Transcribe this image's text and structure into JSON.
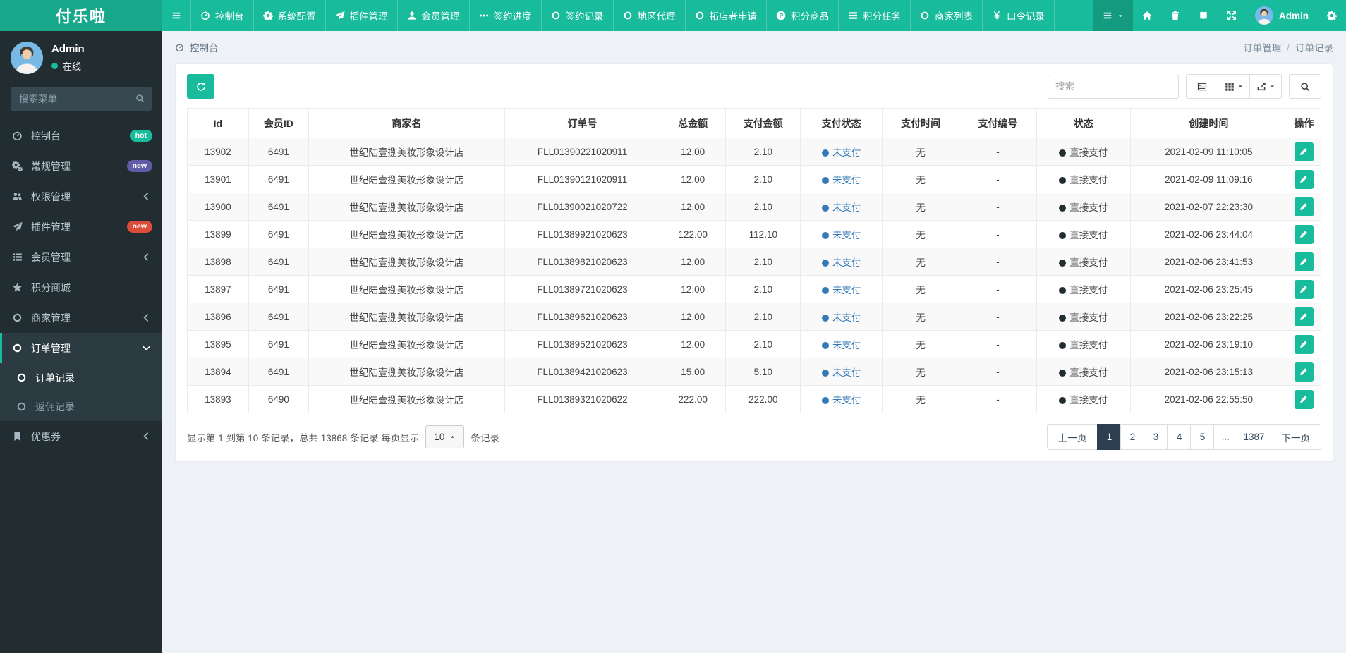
{
  "navbar": {
    "brand": "付乐啦",
    "toggle_icon": "bars",
    "menu": [
      {
        "key": "dashboard",
        "icon": "gauge",
        "label": "控制台"
      },
      {
        "key": "system-config",
        "icon": "gear",
        "label": "系统配置"
      },
      {
        "key": "plugin-manage",
        "icon": "plane",
        "label": "插件管理"
      },
      {
        "key": "member-manage",
        "icon": "user",
        "label": "会员管理"
      },
      {
        "key": "sign-progress",
        "icon": "ellipsis",
        "label": "签约进度"
      },
      {
        "key": "sign-records",
        "icon": "circle-o",
        "label": "签约记录"
      },
      {
        "key": "area-agent",
        "icon": "circle-o",
        "label": "地区代理"
      },
      {
        "key": "shop-applications",
        "icon": "circle-o",
        "label": "拓店者申请"
      },
      {
        "key": "points-goods",
        "icon": "p-circle",
        "label": "积分商品"
      },
      {
        "key": "points-tasks",
        "icon": "th-list",
        "label": "积分任务"
      },
      {
        "key": "merchant-list",
        "icon": "circle-o",
        "label": "商家列表"
      },
      {
        "key": "password-records",
        "icon": "yen",
        "label": "口令记录"
      }
    ],
    "right_icons": [
      {
        "key": "home",
        "icon": "home"
      },
      {
        "key": "clear-cache",
        "icon": "trash"
      },
      {
        "key": "docs",
        "icon": "book"
      },
      {
        "key": "fullscreen",
        "icon": "expand"
      }
    ],
    "user": "Admin"
  },
  "sidebar": {
    "user": {
      "name": "Admin",
      "status": "在线"
    },
    "search_placeholder": "搜索菜单",
    "items": [
      {
        "key": "dashboard",
        "icon": "gauge",
        "label": "控制台",
        "badge": {
          "text": "hot",
          "color": "teal"
        }
      },
      {
        "key": "general-manage",
        "icon": "gears",
        "label": "常规管理",
        "badge": {
          "text": "new",
          "color": "purple"
        }
      },
      {
        "key": "auth-manage",
        "icon": "users",
        "label": "权限管理",
        "collapsible": true
      },
      {
        "key": "plugin-manage",
        "icon": "plane",
        "label": "插件管理",
        "badge": {
          "text": "new",
          "color": "red"
        }
      },
      {
        "key": "member-manage",
        "icon": "th-list",
        "label": "会员管理",
        "collapsible": true
      },
      {
        "key": "points-mall",
        "icon": "star",
        "label": "积分商城"
      },
      {
        "key": "merchant-manage",
        "icon": "circle-o",
        "label": "商家管理",
        "collapsible": true
      },
      {
        "key": "order-manage",
        "icon": "circle-o",
        "label": "订单管理",
        "active": true,
        "expanded": true,
        "children": [
          {
            "key": "order-records",
            "icon": "circle-o",
            "label": "订单记录",
            "active": true
          },
          {
            "key": "rebate-records",
            "icon": "circle-o",
            "label": "返佣记录"
          }
        ]
      },
      {
        "key": "coupons",
        "icon": "bookmark",
        "label": "优惠券",
        "collapsible": true
      }
    ]
  },
  "breadcrumb": {
    "location": "控制台",
    "parent": "订单管理",
    "current": "订单记录"
  },
  "toolbar": {
    "search_placeholder": "搜索"
  },
  "table": {
    "columns": [
      "Id",
      "会员ID",
      "商家名",
      "订单号",
      "总金额",
      "支付金额",
      "支付状态",
      "支付时间",
      "支付编号",
      "状态",
      "创建时间",
      "操作"
    ],
    "column_keys": [
      "id",
      "member-id",
      "merchant",
      "order-no",
      "total",
      "paid",
      "pay-status",
      "pay-time",
      "pay-no",
      "status",
      "created",
      "action"
    ],
    "rows": [
      {
        "id": "13902",
        "member_id": "6491",
        "merchant": "世纪陆壹捌美妆形象设计店",
        "order_no": "FLL01390221020911",
        "total": "12.00",
        "paid": "2.10",
        "pay_status": "未支付",
        "pay_time": "无",
        "pay_no": "-",
        "status": "直接支付",
        "created": "2021-02-09 11:10:05"
      },
      {
        "id": "13901",
        "member_id": "6491",
        "merchant": "世纪陆壹捌美妆形象设计店",
        "order_no": "FLL01390121020911",
        "total": "12.00",
        "paid": "2.10",
        "pay_status": "未支付",
        "pay_time": "无",
        "pay_no": "-",
        "status": "直接支付",
        "created": "2021-02-09 11:09:16"
      },
      {
        "id": "13900",
        "member_id": "6491",
        "merchant": "世纪陆壹捌美妆形象设计店",
        "order_no": "FLL01390021020722",
        "total": "12.00",
        "paid": "2.10",
        "pay_status": "未支付",
        "pay_time": "无",
        "pay_no": "-",
        "status": "直接支付",
        "created": "2021-02-07 22:23:30"
      },
      {
        "id": "13899",
        "member_id": "6491",
        "merchant": "世纪陆壹捌美妆形象设计店",
        "order_no": "FLL01389921020623",
        "total": "122.00",
        "paid": "112.10",
        "pay_status": "未支付",
        "pay_time": "无",
        "pay_no": "-",
        "status": "直接支付",
        "created": "2021-02-06 23:44:04"
      },
      {
        "id": "13898",
        "member_id": "6491",
        "merchant": "世纪陆壹捌美妆形象设计店",
        "order_no": "FLL01389821020623",
        "total": "12.00",
        "paid": "2.10",
        "pay_status": "未支付",
        "pay_time": "无",
        "pay_no": "-",
        "status": "直接支付",
        "created": "2021-02-06 23:41:53"
      },
      {
        "id": "13897",
        "member_id": "6491",
        "merchant": "世纪陆壹捌美妆形象设计店",
        "order_no": "FLL01389721020623",
        "total": "12.00",
        "paid": "2.10",
        "pay_status": "未支付",
        "pay_time": "无",
        "pay_no": "-",
        "status": "直接支付",
        "created": "2021-02-06 23:25:45"
      },
      {
        "id": "13896",
        "member_id": "6491",
        "merchant": "世纪陆壹捌美妆形象设计店",
        "order_no": "FLL01389621020623",
        "total": "12.00",
        "paid": "2.10",
        "pay_status": "未支付",
        "pay_time": "无",
        "pay_no": "-",
        "status": "直接支付",
        "created": "2021-02-06 23:22:25"
      },
      {
        "id": "13895",
        "member_id": "6491",
        "merchant": "世纪陆壹捌美妆形象设计店",
        "order_no": "FLL01389521020623",
        "total": "12.00",
        "paid": "2.10",
        "pay_status": "未支付",
        "pay_time": "无",
        "pay_no": "-",
        "status": "直接支付",
        "created": "2021-02-06 23:19:10"
      },
      {
        "id": "13894",
        "member_id": "6491",
        "merchant": "世纪陆壹捌美妆形象设计店",
        "order_no": "FLL01389421020623",
        "total": "15.00",
        "paid": "5.10",
        "pay_status": "未支付",
        "pay_time": "无",
        "pay_no": "-",
        "status": "直接支付",
        "created": "2021-02-06 23:15:13"
      },
      {
        "id": "13893",
        "member_id": "6490",
        "merchant": "世纪陆壹捌美妆形象设计店",
        "order_no": "FLL01389321020622",
        "total": "222.00",
        "paid": "222.00",
        "pay_status": "未支付",
        "pay_time": "无",
        "pay_no": "-",
        "status": "直接支付",
        "created": "2021-02-06 22:55:50"
      }
    ]
  },
  "footer": {
    "info_prefix": "显示第 1 到第 10 条记录，总共 13868 条记录 每页显示",
    "page_size": "10",
    "info_suffix": "条记录"
  },
  "pagination": {
    "items": [
      {
        "key": "prev",
        "label": "上一页"
      },
      {
        "key": "1",
        "label": "1",
        "active": true
      },
      {
        "key": "2",
        "label": "2"
      },
      {
        "key": "3",
        "label": "3"
      },
      {
        "key": "4",
        "label": "4"
      },
      {
        "key": "5",
        "label": "5"
      },
      {
        "key": "ellipsis",
        "label": "..."
      },
      {
        "key": "1387",
        "label": "1387"
      },
      {
        "key": "next",
        "label": "下一页"
      }
    ]
  },
  "colors": {
    "teal": "#18bc9c",
    "teal-dark": "#17a78a",
    "navbar-active": "#149a7f",
    "sidebar-bg": "#222d32",
    "sidebar-active-bg": "#2c3b41",
    "content-bg": "#eef1f5",
    "link-blue": "#337ab7",
    "navy": "#2c3e50",
    "badge-hot": "#18bc9c",
    "badge-new-purple": "#605ca8",
    "badge-new-red": "#dd4b39"
  }
}
